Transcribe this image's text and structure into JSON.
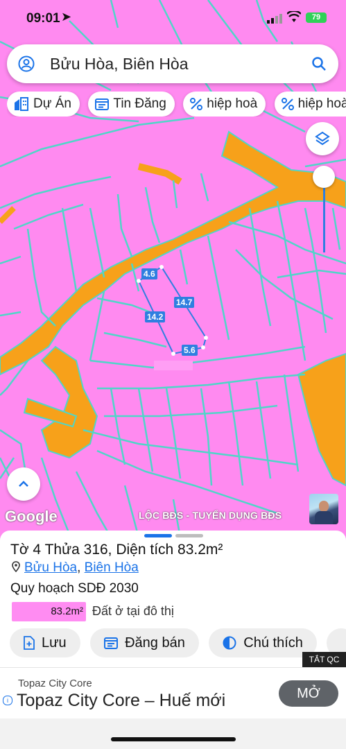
{
  "status_bar": {
    "time": "09:01",
    "battery": "79"
  },
  "search": {
    "query": "Bửu Hòa, Biên Hòa"
  },
  "chips": [
    {
      "icon": "project-icon",
      "label": "Dự Án"
    },
    {
      "icon": "listing-icon",
      "label": "Tin Đăng"
    },
    {
      "icon": "percent-icon",
      "label": "hiệp hoà"
    },
    {
      "icon": "percent-icon",
      "label": "hiệp hoà"
    }
  ],
  "map": {
    "measurements": {
      "top": "4.6",
      "right": "14.7",
      "left": "14.2",
      "bottom": "5.6"
    },
    "google_logo": "Google",
    "watermark": "LỘC BĐS - TUYỂN DỤNG BĐS",
    "colors": {
      "land": "#ff8af0",
      "road": "#f7a11a",
      "boundary": "#4fd6c8",
      "plot": "#2f7fe0"
    }
  },
  "parcel": {
    "title": "Tờ 4 Thửa 316, Diện tích 83.2m²",
    "ward": "Bửu Hòa",
    "separator": ", ",
    "city": "Biên Hòa",
    "plan_label": "Quy hoạch SDĐ 2030",
    "legend_area": "83.2m²",
    "legend_text": "Đất ở tại đô thị"
  },
  "actions": [
    {
      "icon": "save-icon",
      "label": "Lưu"
    },
    {
      "icon": "post-sale-icon",
      "label": "Đăng bán"
    },
    {
      "icon": "legend-icon",
      "label": "Chú thích"
    },
    {
      "icon": "camera-icon",
      "label": ""
    }
  ],
  "ad": {
    "close_label": "TẮT QC",
    "advertiser": "Topaz City Core",
    "headline": "Topaz City Core – Huế mới",
    "cta": "MỞ",
    "info": "i"
  }
}
